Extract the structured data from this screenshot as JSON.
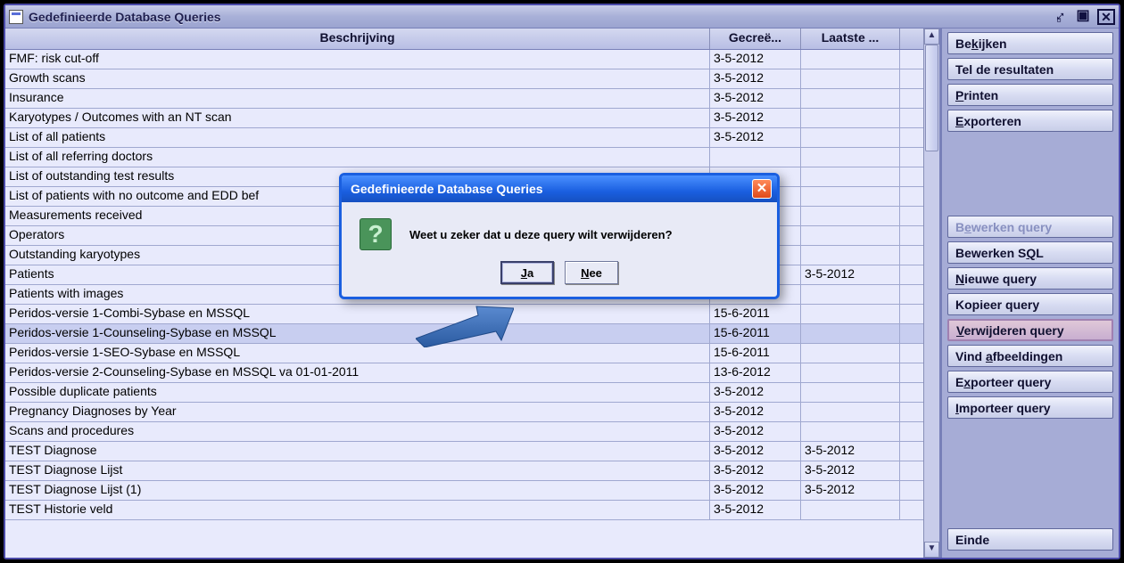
{
  "window": {
    "title": "Gedefinieerde Database Queries"
  },
  "columns": {
    "desc": "Beschrijving",
    "created": "Gecreë...",
    "last": "Laatste ..."
  },
  "rows": [
    {
      "desc": "FMF: risk cut-off",
      "created": "3-5-2012",
      "last": ""
    },
    {
      "desc": "Growth scans",
      "created": "3-5-2012",
      "last": ""
    },
    {
      "desc": "Insurance",
      "created": "3-5-2012",
      "last": ""
    },
    {
      "desc": "Karyotypes / Outcomes with an NT scan",
      "created": "3-5-2012",
      "last": ""
    },
    {
      "desc": "List of all patients",
      "created": "3-5-2012",
      "last": ""
    },
    {
      "desc": "List of all referring doctors",
      "created": "",
      "last": ""
    },
    {
      "desc": "List of outstanding test results",
      "created": "",
      "last": ""
    },
    {
      "desc": "List of patients with no outcome and EDD  bef",
      "created": "",
      "last": ""
    },
    {
      "desc": "Measurements received",
      "created": "",
      "last": ""
    },
    {
      "desc": "Operators",
      "created": "",
      "last": ""
    },
    {
      "desc": "Outstanding karyotypes",
      "created": "",
      "last": ""
    },
    {
      "desc": "Patients",
      "created": "",
      "last": "3-5-2012"
    },
    {
      "desc": "Patients with images",
      "created": "",
      "last": ""
    },
    {
      "desc": "Peridos-versie 1-Combi-Sybase en MSSQL",
      "created": "15-6-2011",
      "last": ""
    },
    {
      "desc": "Peridos-versie 1-Counseling-Sybase en MSSQL",
      "created": "15-6-2011",
      "last": "",
      "selected": true
    },
    {
      "desc": "Peridos-versie 1-SEO-Sybase en MSSQL",
      "created": "15-6-2011",
      "last": ""
    },
    {
      "desc": "Peridos-versie 2-Counseling-Sybase en MSSQL va 01-01-2011",
      "created": "13-6-2012",
      "last": ""
    },
    {
      "desc": "Possible duplicate patients",
      "created": "3-5-2012",
      "last": ""
    },
    {
      "desc": "Pregnancy Diagnoses by Year",
      "created": "3-5-2012",
      "last": ""
    },
    {
      "desc": "Scans and procedures",
      "created": "3-5-2012",
      "last": ""
    },
    {
      "desc": "TEST Diagnose",
      "created": "3-5-2012",
      "last": "3-5-2012"
    },
    {
      "desc": "TEST Diagnose Lijst",
      "created": "3-5-2012",
      "last": "3-5-2012"
    },
    {
      "desc": "TEST Diagnose Lijst (1)",
      "created": "3-5-2012",
      "last": "3-5-2012"
    },
    {
      "desc": "TEST Historie veld",
      "created": "3-5-2012",
      "last": ""
    }
  ],
  "sidebar": {
    "view": "Bekijken",
    "count": "Tel de resultaten",
    "print": "Printen",
    "export": "Exporteren",
    "edit_query": "Bewerken query",
    "edit_sql": "Bewerken SQL",
    "new_query": "Nieuwe query",
    "copy_query": "Kopieer query",
    "delete_query": "Verwijderen query",
    "find_images": "Vind afbeeldingen",
    "export_query": "Exporteer query",
    "import_query": "Importeer query",
    "end": "Einde"
  },
  "dialog": {
    "title": "Gedefinieerde Database Queries",
    "message": "Weet u zeker dat u deze query wilt verwijderen?",
    "yes": "Ja",
    "no": "Nee"
  }
}
